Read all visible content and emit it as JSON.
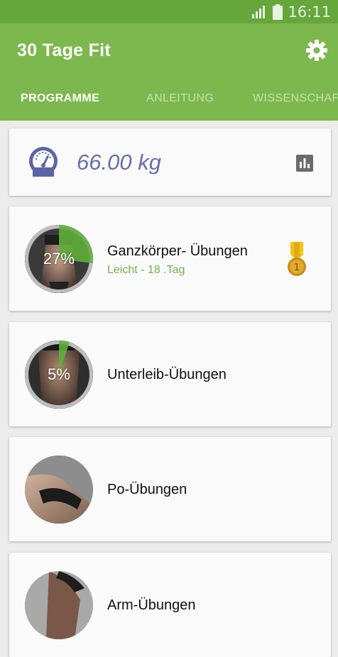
{
  "status_bar": {
    "time": "16:11",
    "signal_icon": "signal-icon",
    "battery_icon": "battery-icon"
  },
  "app_bar": {
    "title": "30 Tage Fit",
    "settings_icon": "gear-icon"
  },
  "tabs": [
    {
      "label": "PROGRAMME",
      "active": true
    },
    {
      "label": "ANLEITUNG",
      "active": false
    },
    {
      "label": "WISSENSCHAF",
      "active": false
    }
  ],
  "weight": {
    "value": "66.00 kg",
    "icon": "gauge-icon",
    "stats_icon": "bar-chart-icon"
  },
  "programs": [
    {
      "title": "Ganzkörper- Übungen",
      "subtitle": "Leicht - 18 .Tag",
      "progress_label": "27%",
      "progress": 0.27,
      "badge_icon": "gold-medal-icon"
    },
    {
      "title": "Unterleib-Übungen",
      "progress_label": "5%",
      "progress": 0.05
    },
    {
      "title": "Po-Übungen"
    },
    {
      "title": "Arm-Übungen"
    }
  ],
  "colors": {
    "status_bar": "#65a73b",
    "app_bar": "#7cb84e",
    "tab_indicator": "#f2e35c",
    "subtitle_green": "#74b24a",
    "weight_text": "#6670a8"
  }
}
